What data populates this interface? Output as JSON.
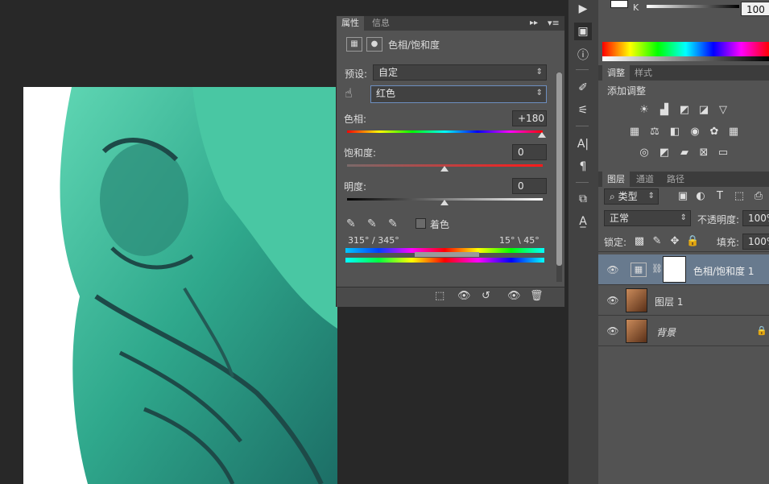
{
  "properties": {
    "tabs": [
      {
        "label": "属性"
      },
      {
        "label": "信息"
      }
    ],
    "title": "色相/饱和度",
    "preset_label": "预设:",
    "preset_value": "自定",
    "channel_value": "红色",
    "hue_label": "色相:",
    "hue_value": "+180",
    "saturation_label": "饱和度:",
    "saturation_value": "0",
    "lightness_label": "明度:",
    "lightness_value": "0",
    "colorize_label": "着色",
    "range_left": "315° / 345°",
    "range_right": "15° \\ 45°"
  },
  "right_top": {
    "channel_letter": "K",
    "k_value": "100"
  },
  "adjustments": {
    "tabs": [
      {
        "label": "调整"
      },
      {
        "label": "样式"
      }
    ],
    "add_label": "添加调整"
  },
  "layers_panel": {
    "tabs": [
      {
        "label": "图层"
      },
      {
        "label": "通道"
      },
      {
        "label": "路径"
      }
    ],
    "filter_value": "类型",
    "blend_mode": "正常",
    "opacity_label": "不透明度:",
    "opacity_value": "100%",
    "lock_label": "锁定:",
    "fill_label": "填充:",
    "fill_value": "100%",
    "layers": [
      {
        "name": "色相/饱和度 1"
      },
      {
        "name": "图层 1"
      },
      {
        "name": "背景"
      }
    ]
  },
  "colors": {
    "panel": "#535353",
    "dark": "#3c3c3c",
    "selected_layer": "#687a8e",
    "statue": "#3bb89a"
  }
}
